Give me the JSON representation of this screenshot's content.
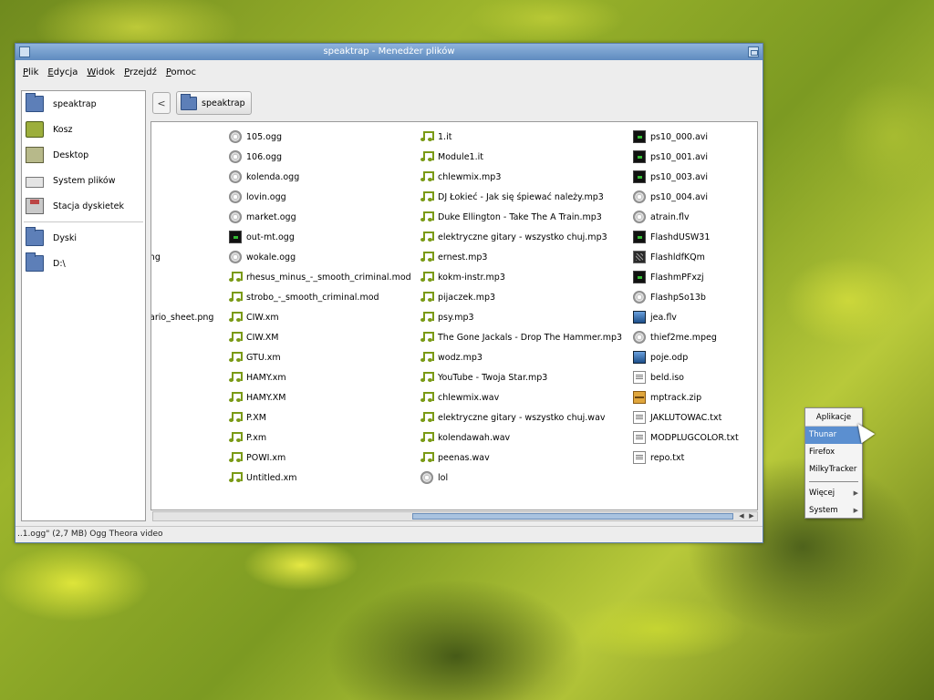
{
  "window": {
    "title": "speaktrap - Menedżer plików"
  },
  "menubar": {
    "items": [
      "Plik",
      "Edycja",
      "Widok",
      "Przejdź",
      "Pomoc"
    ]
  },
  "sidebar": {
    "places": [
      {
        "label": "speaktrap",
        "icon": "home-folder-icon"
      },
      {
        "label": "Kosz",
        "icon": "trash-icon"
      },
      {
        "label": "Desktop",
        "icon": "desktop-icon"
      },
      {
        "label": "System plików",
        "icon": "filesystem-icon"
      },
      {
        "label": "Stacja dyskietek",
        "icon": "floppy-icon"
      }
    ],
    "devices": [
      {
        "label": "Dyski",
        "icon": "folder-icon"
      },
      {
        "label": "D:\\",
        "icon": "folder-icon"
      }
    ]
  },
  "pathbar": {
    "back_label": "<",
    "current": "speaktrap"
  },
  "files": {
    "col0": [
      {
        "name": "",
        "type": "none"
      },
      {
        "name": "",
        "type": "none"
      },
      {
        "name": "",
        "type": "none"
      },
      {
        "name": "",
        "type": "none"
      },
      {
        "name": "",
        "type": "none"
      },
      {
        "name": "",
        "type": "none"
      },
      {
        "name": "ong",
        "type": "none"
      },
      {
        "name": "",
        "type": "none"
      },
      {
        "name": "",
        "type": "none"
      },
      {
        "name": "nario_sheet.png",
        "type": "none"
      }
    ],
    "col1": [
      {
        "name": "105.ogg",
        "type": "media"
      },
      {
        "name": "106.ogg",
        "type": "media"
      },
      {
        "name": "kolenda.ogg",
        "type": "media"
      },
      {
        "name": "lovin.ogg",
        "type": "media"
      },
      {
        "name": "market.ogg",
        "type": "media"
      },
      {
        "name": "out-mt.ogg",
        "type": "video"
      },
      {
        "name": "wokale.ogg",
        "type": "media"
      },
      {
        "name": "rhesus_minus_-_smooth_criminal.mod",
        "type": "audio"
      },
      {
        "name": "strobo_-_smooth_criminal.mod",
        "type": "audio"
      },
      {
        "name": "CIW.xm",
        "type": "audio"
      },
      {
        "name": "CIW.XM",
        "type": "audio"
      },
      {
        "name": "GTU.xm",
        "type": "audio"
      },
      {
        "name": "HAMY.xm",
        "type": "audio"
      },
      {
        "name": "HAMY.XM",
        "type": "audio"
      },
      {
        "name": "P.XM",
        "type": "audio"
      },
      {
        "name": "P.xm",
        "type": "audio"
      },
      {
        "name": "POWI.xm",
        "type": "audio"
      },
      {
        "name": "Untitled.xm",
        "type": "audio"
      }
    ],
    "col2": [
      {
        "name": "1.it",
        "type": "audio"
      },
      {
        "name": "Module1.it",
        "type": "audio"
      },
      {
        "name": "chlewmix.mp3",
        "type": "audio"
      },
      {
        "name": "DJ Łokieć - Jak się śpiewać należy.mp3",
        "type": "audio"
      },
      {
        "name": "Duke Ellington - Take The A Train.mp3",
        "type": "audio"
      },
      {
        "name": "elektryczne gitary - wszystko chuj.mp3",
        "type": "audio"
      },
      {
        "name": "ernest.mp3",
        "type": "audio"
      },
      {
        "name": "kokm-instr.mp3",
        "type": "audio"
      },
      {
        "name": "pijaczek.mp3",
        "type": "audio"
      },
      {
        "name": "psy.mp3",
        "type": "audio"
      },
      {
        "name": "The Gone Jackals - Drop The Hammer.mp3",
        "type": "audio"
      },
      {
        "name": "wodz.mp3",
        "type": "audio"
      },
      {
        "name": "YouTube - Twoja Star.mp3",
        "type": "audio"
      },
      {
        "name": "chlewmix.wav",
        "type": "audio"
      },
      {
        "name": "elektryczne gitary - wszystko chuj.wav",
        "type": "audio"
      },
      {
        "name": "kolendawah.wav",
        "type": "audio"
      },
      {
        "name": "peenas.wav",
        "type": "audio"
      },
      {
        "name": "lol",
        "type": "media"
      }
    ],
    "col3": [
      {
        "name": "ps10_000.avi",
        "type": "video"
      },
      {
        "name": "ps10_001.avi",
        "type": "video"
      },
      {
        "name": "ps10_003.avi",
        "type": "video"
      },
      {
        "name": "ps10_004.avi",
        "type": "media"
      },
      {
        "name": "atrain.flv",
        "type": "media"
      },
      {
        "name": "FlashdUSW31",
        "type": "video"
      },
      {
        "name": "FlashldfKQm",
        "type": "flash"
      },
      {
        "name": "FlashmPFxzj",
        "type": "video"
      },
      {
        "name": "FlashpSo13b",
        "type": "media"
      },
      {
        "name": "jea.flv",
        "type": "image"
      },
      {
        "name": "thief2me.mpeg",
        "type": "media"
      },
      {
        "name": "poje.odp",
        "type": "image"
      },
      {
        "name": "beld.iso",
        "type": "text"
      },
      {
        "name": "mptrack.zip",
        "type": "zip"
      },
      {
        "name": "JAKLUTOWAC.txt",
        "type": "text"
      },
      {
        "name": "MODPLUGCOLOR.txt",
        "type": "text"
      },
      {
        "name": "repo.txt",
        "type": "text"
      }
    ]
  },
  "statusbar": {
    "text": "..1.ogg\" (2,7 MB) Ogg Theora video"
  },
  "appmenu": {
    "title": "Aplikacje",
    "items": [
      {
        "label": "Thunar",
        "active": true,
        "submenu": false
      },
      {
        "label": "Firefox",
        "active": false,
        "submenu": false
      },
      {
        "label": "MilkyTracker",
        "active": false,
        "submenu": false
      },
      {
        "label": "Więcej",
        "active": false,
        "submenu": true
      },
      {
        "label": "System",
        "active": false,
        "submenu": true
      }
    ]
  },
  "colors": {
    "titlebar": "#5f8bbf",
    "selection": "#5b8fd0",
    "audio_icon": "#7a9a16"
  }
}
